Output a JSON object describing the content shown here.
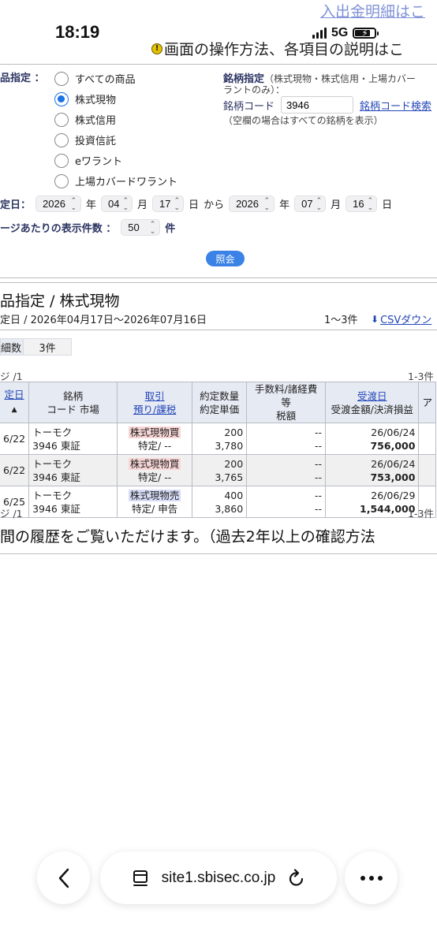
{
  "status_bar": {
    "time": "18:19",
    "network": "5G",
    "battery_level": 0.7
  },
  "header": {
    "top_link": "入出金明細はこ",
    "help_text": "画面の操作方法、各項目の説明はこ"
  },
  "form": {
    "product_label": "品指定 ：",
    "product_options": [
      "すべての商品",
      "株式現物",
      "株式信用",
      "投資信託",
      "eワラント",
      "上場カバードワラント"
    ],
    "selected_option": "株式現物",
    "brand_label": "銘柄指定",
    "brand_note_1": "（株式現物・株式信用・上場カバー",
    "brand_note_2": "ラントのみ）：",
    "brand_code_label": "銘柄コード",
    "brand_code_value": "3946",
    "brand_search_link": "銘柄コード検索",
    "brand_blank_note": "（空欄の場合はすべての銘柄を表示）",
    "date_label": "定日：",
    "from_year": "2026",
    "from_month": "04",
    "from_day": "17",
    "to_year": "2026",
    "to_month": "07",
    "to_day": "16",
    "unit_year": "年",
    "unit_month": "月",
    "unit_day": "日",
    "from_word": "から",
    "per_page_label": "ージあたりの表示件数 ：",
    "per_page_value": "50",
    "per_page_unit": "件",
    "submit_label": "照会"
  },
  "results": {
    "title": "品指定 / 株式現物",
    "period": "定日 / 2026年04月17日〜2026年07月16日",
    "range": "1〜3件",
    "csv_link": "CSVダウン",
    "count_label": "細数",
    "count_value": "3件",
    "page_left_top": "ジ /1",
    "page_right_top": "1-3件",
    "page_left_bottom": "ジ /1",
    "page_right_bottom": "1-3件"
  },
  "table": {
    "headers": {
      "date": "定日",
      "brand_1": "銘柄",
      "brand_2": "コード 市場",
      "trade_1": "取引",
      "trade_2": "預り/課税",
      "qty_1": "約定数量",
      "qty_2": "約定単価",
      "fee_1": "手数料/諸経費等",
      "fee_2": "税額",
      "settle_1": "受渡日",
      "settle_2": "受渡金額/決済損益",
      "extra": "ア"
    },
    "rows": [
      {
        "date": "6/22",
        "name": "トーモク",
        "code_market": "3946 東証",
        "trade": "株式現物買",
        "trade_type": "buy",
        "account": "特定/ --",
        "qty": "200",
        "price": "3,780",
        "fee": "--",
        "tax": "--",
        "settle_date": "26/06/24",
        "amount": "756,000"
      },
      {
        "date": "6/22",
        "name": "トーモク",
        "code_market": "3946 東証",
        "trade": "株式現物買",
        "trade_type": "buy",
        "account": "特定/ --",
        "qty": "200",
        "price": "3,765",
        "fee": "--",
        "tax": "--",
        "settle_date": "26/06/24",
        "amount": "753,000"
      },
      {
        "date": "6/25",
        "name": "トーモク",
        "code_market": "3946 東証",
        "trade": "株式現物売",
        "trade_type": "sell",
        "account": "特定/ 申告",
        "qty": "400",
        "price": "3,860",
        "fee": "--",
        "tax": "--",
        "settle_date": "26/06/29",
        "amount": "1,544,000"
      }
    ]
  },
  "footnote": "間の履歴をご覧いただけます。（過去2年以上の確認方法",
  "browser": {
    "url": "site1.sbisec.co.jp"
  }
}
